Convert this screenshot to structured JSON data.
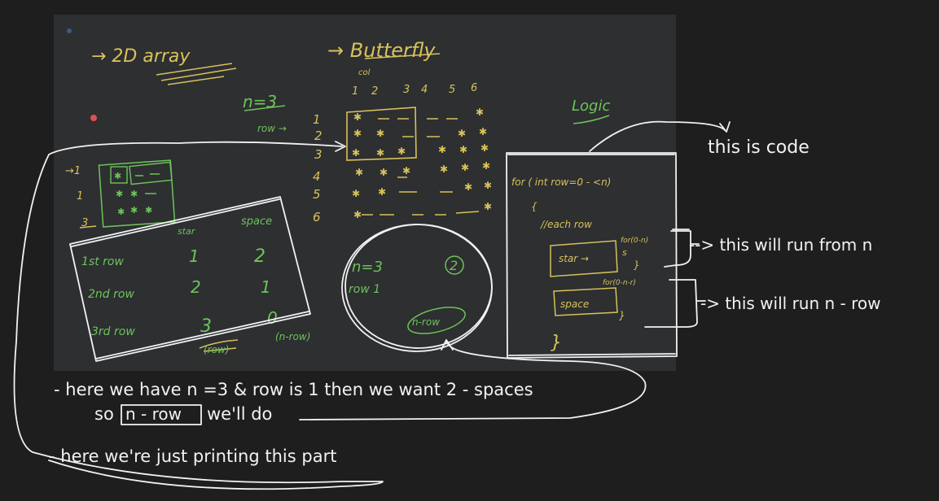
{
  "colors": {
    "page_bg": "#1e1e1e",
    "board_bg": "#2d2f31",
    "white_ink": "#f2f2f2",
    "yellow_ink": "#d8c15a",
    "green_ink": "#6ec35a",
    "red_dot": "#e05050"
  },
  "board": {
    "title_left": "→ 2D array",
    "title_right": "→ Butterfly",
    "col_header": "col",
    "col_numbers": [
      "1",
      "2",
      "3",
      "4",
      "5",
      "6"
    ],
    "row_label": "row →",
    "n_label": "n=3",
    "row_numbers": [
      "1",
      "2",
      "3",
      "4",
      "5",
      "6"
    ],
    "logic_label": "Logic",
    "table_header": [
      "star",
      "space"
    ],
    "table_rows": [
      {
        "row": "1st row",
        "star": "1",
        "space": "2"
      },
      {
        "row": "2nd row",
        "star": "2",
        "space": "1"
      },
      {
        "row": "3rd row",
        "star": "3",
        "space": "0"
      }
    ],
    "table_footer": [
      "(row)",
      "(n-row)"
    ],
    "circle_note": {
      "line1": "n=3",
      "line2": "row 1",
      "badge": "2",
      "formula": "n-row"
    },
    "code": {
      "line1": "for ( int row=0 - <n)",
      "line2": "{",
      "line3": "//each row",
      "star": "star →",
      "for1": "for(0-n)",
      "s": "s",
      "close1": "}",
      "for2": "for(0-n-r)",
      "space": "space",
      "close2": "}",
      "close_main": "}"
    }
  },
  "annotations": {
    "code_label": "this is code",
    "run1": "--> this will run from n",
    "run2": "-> this will run n - row",
    "bottom1_a": "- here we have n =3 & row is 1 then we want 2 - spaces",
    "bottom1_b_pre": "so",
    "bottom1_b_box": "n - row",
    "bottom1_b_post": "we'll do",
    "bottom2": "- here we're just printing this part"
  }
}
